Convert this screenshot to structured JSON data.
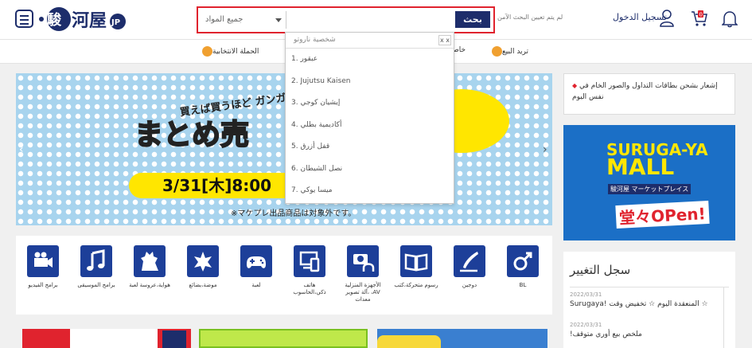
{
  "header": {
    "logo_text": "駿河屋",
    "logo_badge": "JP",
    "search": {
      "category": "جميع المواد",
      "value": "",
      "button": "بحث",
      "hint": "لم يتم تعيين البحث الآمن"
    },
    "login": "تسجيل الدخول",
    "cart_count": "0"
  },
  "nav": {
    "items": [
      "الحملة الانتخابية",
      "خاصية ممـ",
      "تريد البيع"
    ]
  },
  "suggestions": {
    "header": "شخصية ناروتو",
    "close": "x x",
    "items": [
      "عبقور .1",
      "2. Jujutsu Kaisen",
      "إيشيان كوجي .3",
      "أكاديمية بطلي .4",
      "قفل أزرق .5",
      "نصل الشيطان .6",
      "ميسا يوكي .7"
    ]
  },
  "banner": {
    "line1": "買えば買うほど ガンガン割引!",
    "headline": "まとめ売",
    "date": "3/31[木]8:00",
    "note": "※マケプレ出品商品は対象外です。",
    "prev": "‹",
    "next": "›"
  },
  "categories": [
    {
      "label": "برامج الفيديو",
      "icon": "video-camera-icon"
    },
    {
      "label": "برامج الموسيقى",
      "icon": "music-note-icon"
    },
    {
      "label": "هواية،عروسة لعبة",
      "icon": "monster-icon"
    },
    {
      "label": "موضة،بضائع",
      "icon": "star-badge-icon"
    },
    {
      "label": "لعبة",
      "icon": "gamepad-icon"
    },
    {
      "label": "هاتف ذكي،الحاسوب",
      "icon": "devices-icon"
    },
    {
      "label": "الأجهزة المنزلية ،آلة تصوير ،AV معدات",
      "icon": "camera-headphones-icon"
    },
    {
      "label": "رسوم متحركة،كتب",
      "icon": "book-icon"
    },
    {
      "label": "دوجين",
      "icon": "pen-icon"
    },
    {
      "label": "BL",
      "icon": "male-symbol-icon"
    }
  ],
  "notice": {
    "text": "إشعار بشحن بطاقات التداول والصور الخام في نفس اليوم"
  },
  "mall": {
    "title_line1": "SURUGA-YA",
    "title_line2": "MALL",
    "subtitle": "駿河屋 マーケットプレイス",
    "open": "堂々OPen!"
  },
  "changelog": {
    "title": "سجل التغيير",
    "entries": [
      {
        "date": "2022/03/31",
        "text": "Surugaya! المنعقدة اليوم ☆ تخفيض وقت ☆"
      },
      {
        "date": "2022/03/31",
        "text": "!ملخص بيع أوري متوقف"
      }
    ]
  },
  "colors": {
    "brand_navy": "#1d2d6b",
    "accent_red": "#e0232e",
    "category_blue": "#1d3f99"
  }
}
